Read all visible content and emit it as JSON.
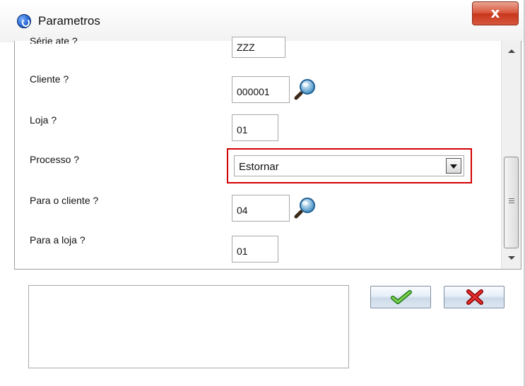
{
  "window": {
    "title": "Parametros",
    "close_icon": "close-icon"
  },
  "params": [
    {
      "label": "Série ate ?",
      "value": "ZZZ",
      "lookup": false
    },
    {
      "label": "Cliente ?",
      "value": "000001",
      "lookup": true
    },
    {
      "label": "Loja ?",
      "value": "01",
      "lookup": false
    },
    {
      "label": "Processo ?",
      "value": "Estornar",
      "type": "select"
    },
    {
      "label": "Para o cliente ?",
      "value": "04",
      "lookup": true
    },
    {
      "label": "Para a loja ?",
      "value": "01",
      "lookup": false
    }
  ],
  "buttons": {
    "confirm_icon": "checkmark-icon",
    "cancel_icon": "red-x-icon"
  },
  "colors": {
    "highlight_border": "#d40000",
    "close_button": "#c7361c"
  }
}
